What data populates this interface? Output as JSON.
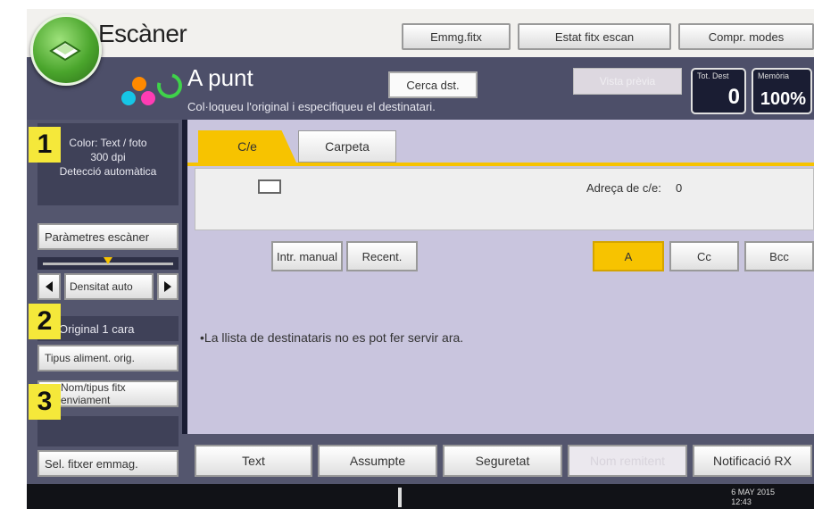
{
  "app": {
    "title": "Escàner"
  },
  "toolbar": {
    "store_file": "Emmg.fitx",
    "file_status": "Estat fitx escan",
    "check_modes": "Compr. modes"
  },
  "status": {
    "main": "A punt",
    "sub": "Col·loqueu l'original i especifiqueu el destinatari.",
    "search_dest": "Cerca dst.",
    "preview": "Vista prèvia",
    "total_dest_label": "Tot. Dest",
    "total_dest_value": "0",
    "memory_label": "Memòria",
    "memory_value": "100%"
  },
  "left": {
    "badges": [
      "1",
      "2",
      "3"
    ],
    "scan_info": [
      "Color: Text / foto",
      "300 dpi",
      "Detecció automàtica"
    ],
    "scan_params": "Paràmetres escàner",
    "density": "Densitat auto",
    "original": "Original 1 cara",
    "feed_type": "Tipus aliment. orig.",
    "send_file_type": "Nom/tipus fitx enviament",
    "select_stored": "Sel. fitxer emmag."
  },
  "tabs": [
    {
      "label": "C/e",
      "active": true
    },
    {
      "label": "Carpeta",
      "active": false
    }
  ],
  "dest": {
    "address_label": "Adreça de c/e:",
    "address_count": "0",
    "manual": "Intr. manual",
    "recent": "Recent.",
    "to": "A",
    "cc": "Cc",
    "bcc": "Bcc"
  },
  "notice": "•La llista de destinataris no es pot fer servir ara.",
  "bottom": {
    "text": "Text",
    "subject": "Assumpte",
    "security": "Seguretat",
    "file_name": "Nom remitent",
    "rx_notice": "Notificació RX"
  },
  "footer": {
    "date": "6 MAY 2015",
    "time": "12:43"
  },
  "colors": {
    "accent": "#f7c300",
    "badge": "#f5e83a",
    "bg_dark": "#1a1d33"
  }
}
